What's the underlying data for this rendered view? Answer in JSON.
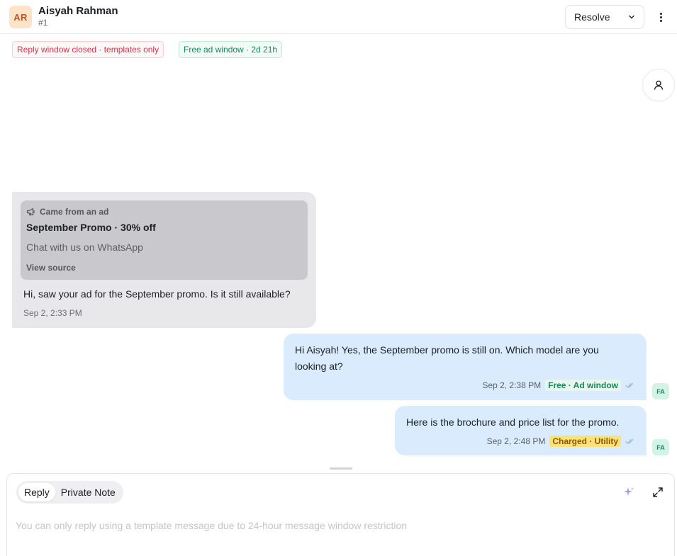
{
  "contact": {
    "initials": "AR",
    "name": "Aisyah Rahman",
    "id": "#1"
  },
  "header": {
    "resolve_label": "Resolve",
    "icons": [
      "chevron-down-icon",
      "more-vertical-icon"
    ]
  },
  "badges": {
    "reply_window": "Reply window closed · templates only",
    "ad_window": "Free ad window · 2d 21h"
  },
  "messages": {
    "incoming": {
      "ad": {
        "label": "Came from an ad",
        "title": "September Promo · 30% off",
        "subtitle": "Chat with us on WhatsApp",
        "link": "View source"
      },
      "text": "Hi, saw your ad for the September promo. Is it still available?",
      "time": "Sep 2, 2:33 PM"
    },
    "outgoing": [
      {
        "text": "Hi Aisyah! Yes, the September promo is still on. Which model are you looking at?",
        "time": "Sep 2, 2:38 PM",
        "tag": "Free · Ad window",
        "agent": "FA"
      },
      {
        "text": "Here is the brochure and price list for the promo.",
        "time": "Sep 2, 2:48 PM",
        "tag": "Charged · Utility",
        "agent": "FA"
      }
    ]
  },
  "composer": {
    "tabs": [
      "Reply",
      "Private Note"
    ],
    "active_tab": "Reply",
    "placeholder": "You can only reply using a template message due to 24-hour message window restriction"
  },
  "colors": {
    "accent_blue_bubble": "#d9ebfc",
    "incoming_bubble": "#e8e8eb",
    "danger": "#d5324e",
    "success": "#17875b",
    "charged": "#fde27a"
  }
}
